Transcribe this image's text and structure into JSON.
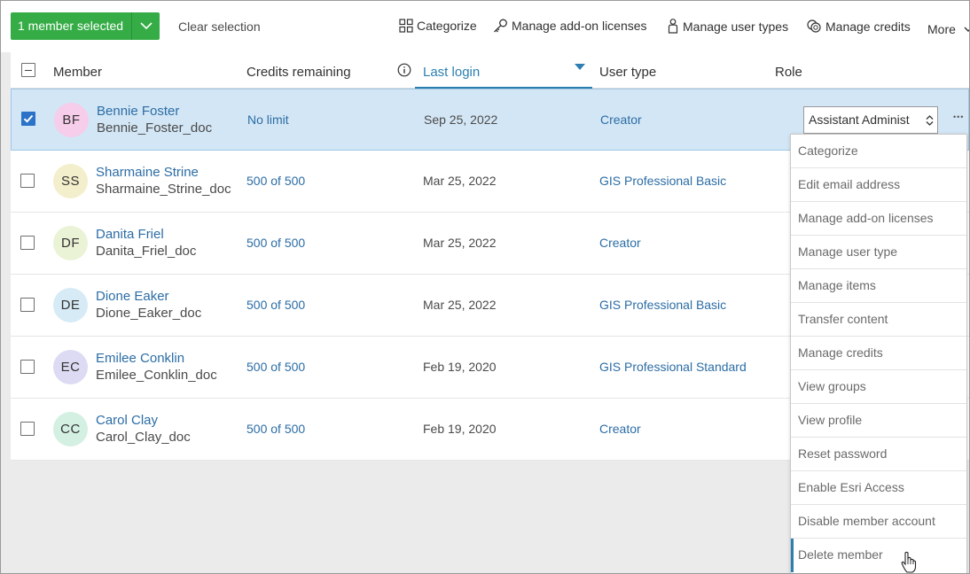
{
  "toolbar": {
    "selected_label": "1 member selected",
    "clear_selection": "Clear selection",
    "categorize": "Categorize",
    "manage_addon_licenses": "Manage add-on licenses",
    "manage_user_types": "Manage user types",
    "manage_credits": "Manage credits",
    "more": "More"
  },
  "table": {
    "headers": {
      "member": "Member",
      "credits": "Credits remaining",
      "last_login": "Last login",
      "user_type": "User type",
      "role": "Role"
    },
    "rows": [
      {
        "initials": "BF",
        "name": "Bennie Foster",
        "username": "Bennie_Foster_doc",
        "credits": "No limit",
        "last_login": "Sep 25, 2022",
        "user_type": "Creator",
        "avatar_color": "#f6cdea",
        "role": "Assistant Administ",
        "checked": true
      },
      {
        "initials": "SS",
        "name": "Sharmaine Strine",
        "username": "Sharmaine_Strine_doc",
        "credits": "500 of 500",
        "last_login": "Mar 25, 2022",
        "user_type": "GIS Professional Basic",
        "avatar_color": "#f3efcc",
        "checked": false
      },
      {
        "initials": "DF",
        "name": "Danita Friel",
        "username": "Danita_Friel_doc",
        "credits": "500 of 500",
        "last_login": "Mar 25, 2022",
        "user_type": "Creator",
        "avatar_color": "#eaf3d6",
        "checked": false
      },
      {
        "initials": "DE",
        "name": "Dione Eaker",
        "username": "Dione_Eaker_doc",
        "credits": "500 of 500",
        "last_login": "Mar 25, 2022",
        "user_type": "GIS Professional Basic",
        "avatar_color": "#d6ebf6",
        "checked": false
      },
      {
        "initials": "EC",
        "name": "Emilee Conklin",
        "username": "Emilee_Conklin_doc",
        "credits": "500 of 500",
        "last_login": "Feb 19, 2020",
        "user_type": "GIS Professional Standard",
        "avatar_color": "#dcdbf3",
        "checked": false
      },
      {
        "initials": "CC",
        "name": "Carol Clay",
        "username": "Carol_Clay_doc",
        "credits": "500 of 500",
        "last_login": "Feb 19, 2020",
        "user_type": "Creator",
        "avatar_color": "#d4f0e2",
        "checked": false
      }
    ]
  },
  "menu": {
    "items": [
      "Categorize",
      "Edit email address",
      "Manage add-on licenses",
      "Manage user type",
      "Manage items",
      "Transfer content",
      "Manage credits",
      "View groups",
      "View profile",
      "Reset password",
      "Enable Esri Access",
      "Disable member account",
      "Delete member"
    ]
  },
  "colors": {
    "accent_green": "#35ac46",
    "link_blue": "#2c6da5",
    "active_blue": "#2c7fb0",
    "selected_row": "#d3e6f5"
  }
}
